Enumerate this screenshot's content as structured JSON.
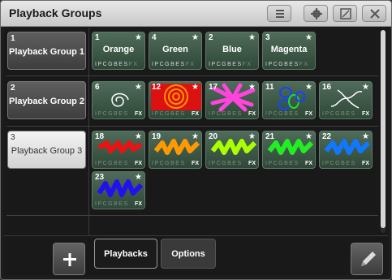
{
  "window": {
    "title": "Playback Groups"
  },
  "title_buttons": {
    "menu": "menu-icon",
    "settings": "gear-icon",
    "resize": "resize-icon",
    "close": "close-icon"
  },
  "groups": [
    {
      "num": "1",
      "label": "Playback Group 1",
      "selected": false
    },
    {
      "num": "2",
      "label": "Playback Group 2",
      "selected": false
    },
    {
      "num": "3",
      "label": "Playback Group 3",
      "selected": true
    }
  ],
  "attrs_text": "IPCGBES",
  "fx_text": "FX",
  "playbacks": {
    "row1": [
      {
        "num": "1",
        "name": "Orange"
      },
      {
        "num": "4",
        "name": "Green"
      },
      {
        "num": "2",
        "name": "Blue"
      },
      {
        "num": "3",
        "name": "Magenta"
      }
    ],
    "row2": [
      {
        "num": "6",
        "art": "spiral-white"
      },
      {
        "num": "12",
        "art": "spiral-red"
      },
      {
        "num": "17",
        "art": "burst-pink"
      },
      {
        "num": "11",
        "art": "circles-blue-green"
      },
      {
        "num": "16",
        "art": "swirl-white"
      }
    ],
    "row3": [
      {
        "num": "18",
        "art": "zigzag",
        "color": "#ee1111"
      },
      {
        "num": "19",
        "art": "zigzag",
        "color": "#ff9900"
      },
      {
        "num": "20",
        "art": "zigzag",
        "color": "#aaff00"
      },
      {
        "num": "21",
        "art": "zigzag",
        "color": "#22ee22"
      },
      {
        "num": "22",
        "art": "zigzag",
        "color": "#1177ff"
      },
      {
        "num": "23",
        "art": "zigzag",
        "color": "#2211ee"
      }
    ]
  },
  "star": "★",
  "bottom": {
    "add_icon": "plus-icon",
    "tabs": [
      {
        "label": "Playbacks",
        "active": true
      },
      {
        "label": "Options",
        "active": false
      }
    ],
    "edit_icon": "pencil-icon"
  }
}
